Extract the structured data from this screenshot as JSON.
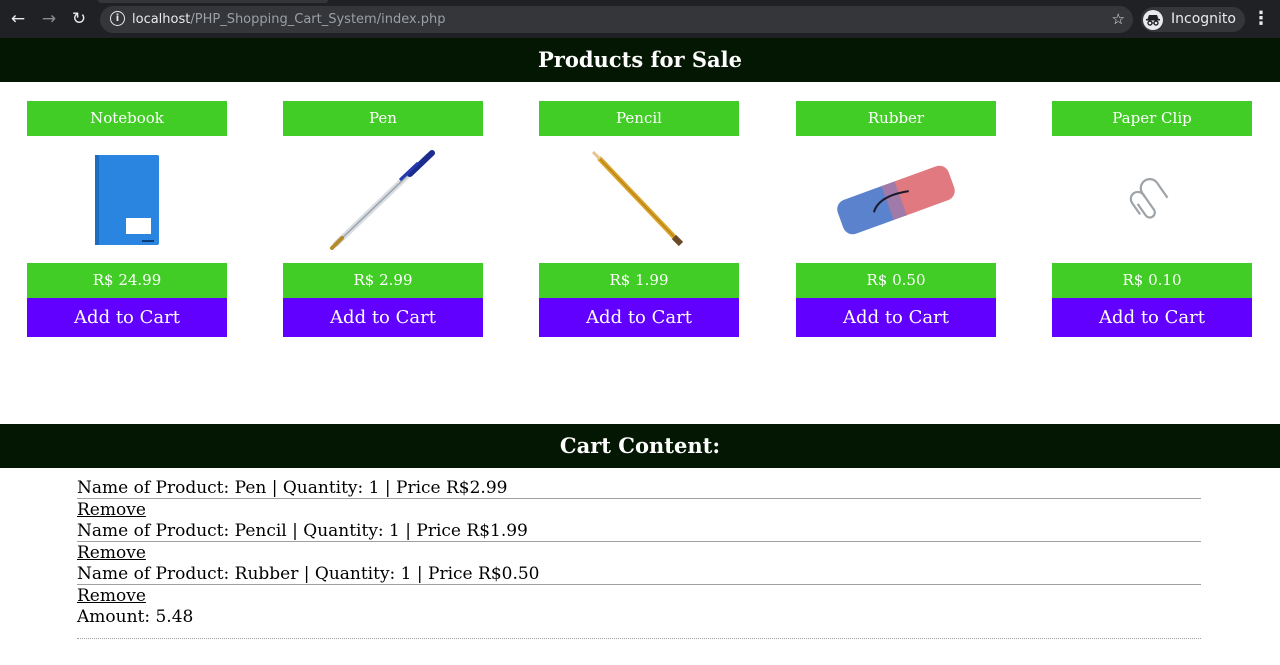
{
  "browser": {
    "url_host": "localhost",
    "url_path": "/PHP_Shopping_Cart_System/index.php",
    "incognito_label": "Incognito"
  },
  "page": {
    "products_title": "Products for Sale",
    "cart_title": "Cart Content:"
  },
  "products": [
    {
      "name": "Notebook",
      "price": "R$ 24.99",
      "button": "Add to Cart"
    },
    {
      "name": "Pen",
      "price": "R$ 2.99",
      "button": "Add to Cart"
    },
    {
      "name": "Pencil",
      "price": "R$ 1.99",
      "button": "Add to Cart"
    },
    {
      "name": "Rubber",
      "price": "R$ 0.50",
      "button": "Add to Cart"
    },
    {
      "name": "Paper Clip",
      "price": "R$ 0.10",
      "button": "Add to Cart"
    }
  ],
  "cart": {
    "items": [
      {
        "text": "Name of Product: Pen | Quantity: 1 | Price R$2.99",
        "remove": "Remove"
      },
      {
        "text": "Name of Product: Pencil | Quantity: 1 | Price R$1.99",
        "remove": "Remove"
      },
      {
        "text": "Name of Product: Rubber | Quantity: 1 | Price R$0.50",
        "remove": "Remove"
      }
    ],
    "amount": "Amount: 5.48"
  },
  "colors": {
    "header_bar": "#031702",
    "product_green": "#41cd25",
    "button_purple": "#6100fe"
  }
}
